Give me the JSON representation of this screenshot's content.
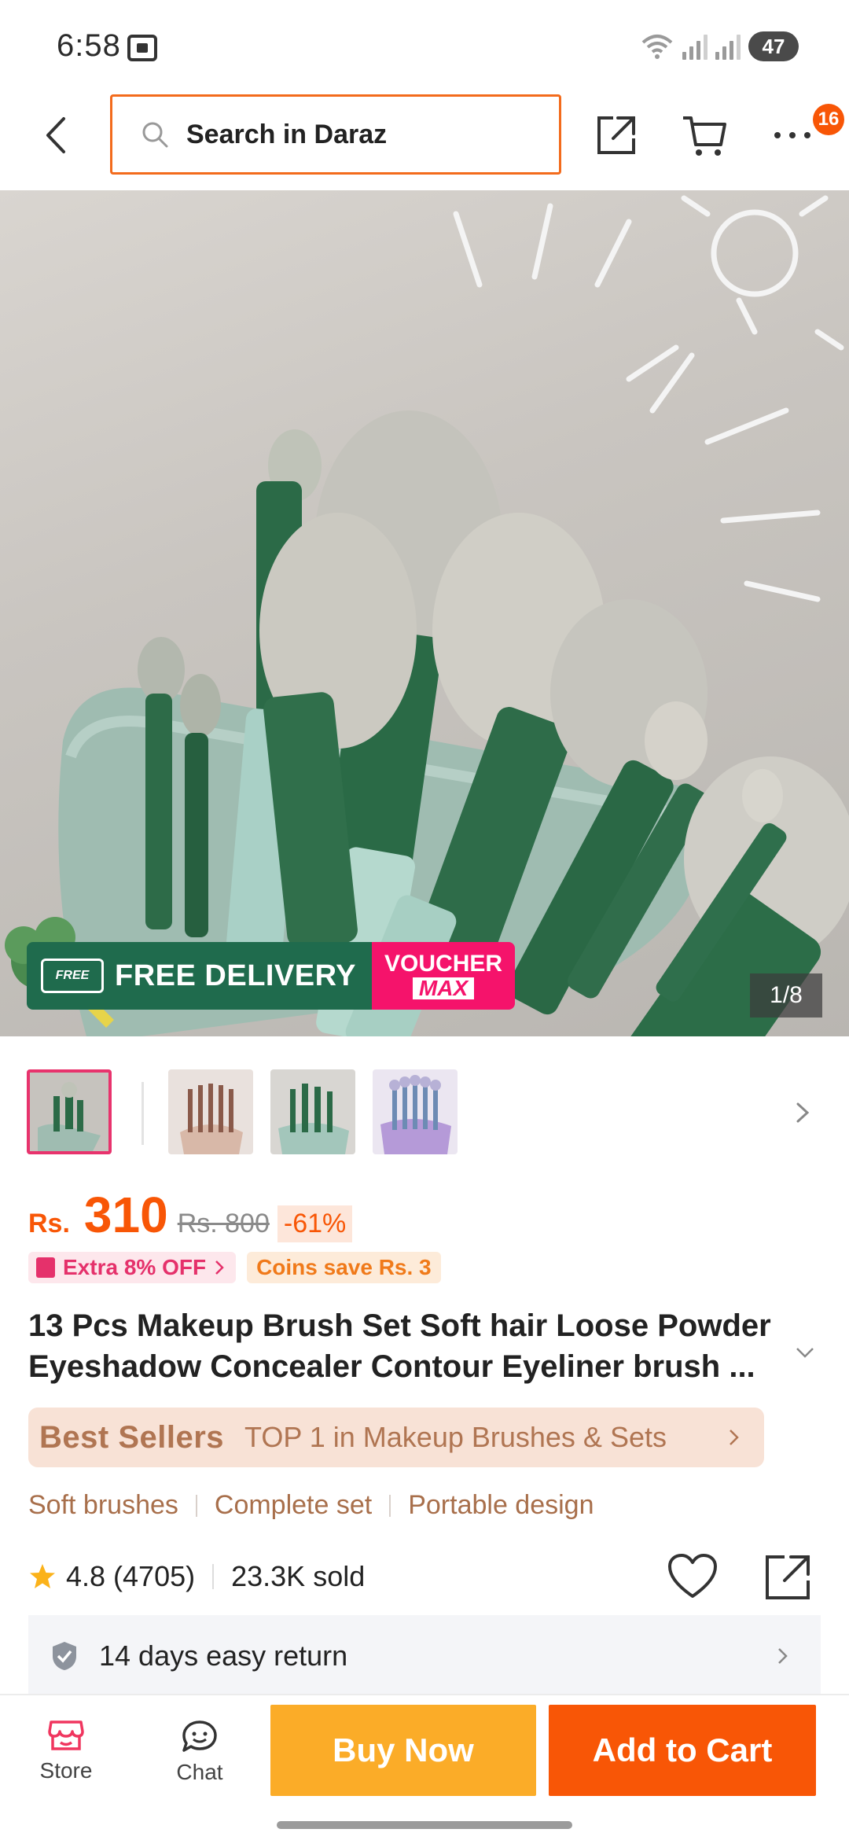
{
  "status_bar": {
    "time": "6:58",
    "battery": "47"
  },
  "header": {
    "search_placeholder": "Search in Daraz",
    "cart_badge": "16"
  },
  "hero": {
    "promo_free_tag": "FREE",
    "promo_free_text": "FREE DELIVERY",
    "promo_voucher_line1": "VOUCHER",
    "promo_voucher_line2": "MAX",
    "image_counter": "1/8"
  },
  "product": {
    "currency": "Rs.",
    "price": "310",
    "original_price": "Rs. 800",
    "discount": "-61%",
    "offer_extra": "Extra 8% OFF",
    "offer_coins": "Coins save Rs. 3",
    "title": "13 Pcs Makeup Brush Set Soft hair Loose Powder Eyeshadow Concealer Contour Eyeliner brush ...",
    "bestseller_label": "Best Sellers",
    "bestseller_text": "TOP 1 in Makeup Brushes & Sets",
    "tags": [
      "Soft brushes",
      "Complete set",
      "Portable design"
    ],
    "rating": "4.8 (4705)",
    "sold": "23.3K sold",
    "return_policy": "14 days easy return"
  },
  "bottom_bar": {
    "store_label": "Store",
    "chat_label": "Chat",
    "buy_now": "Buy Now",
    "add_to_cart": "Add to Cart"
  },
  "colors": {
    "accent": "#f85606",
    "buy_now": "#fbac28",
    "voucher": "#f5136b",
    "free_delivery": "#1f6b4d"
  }
}
